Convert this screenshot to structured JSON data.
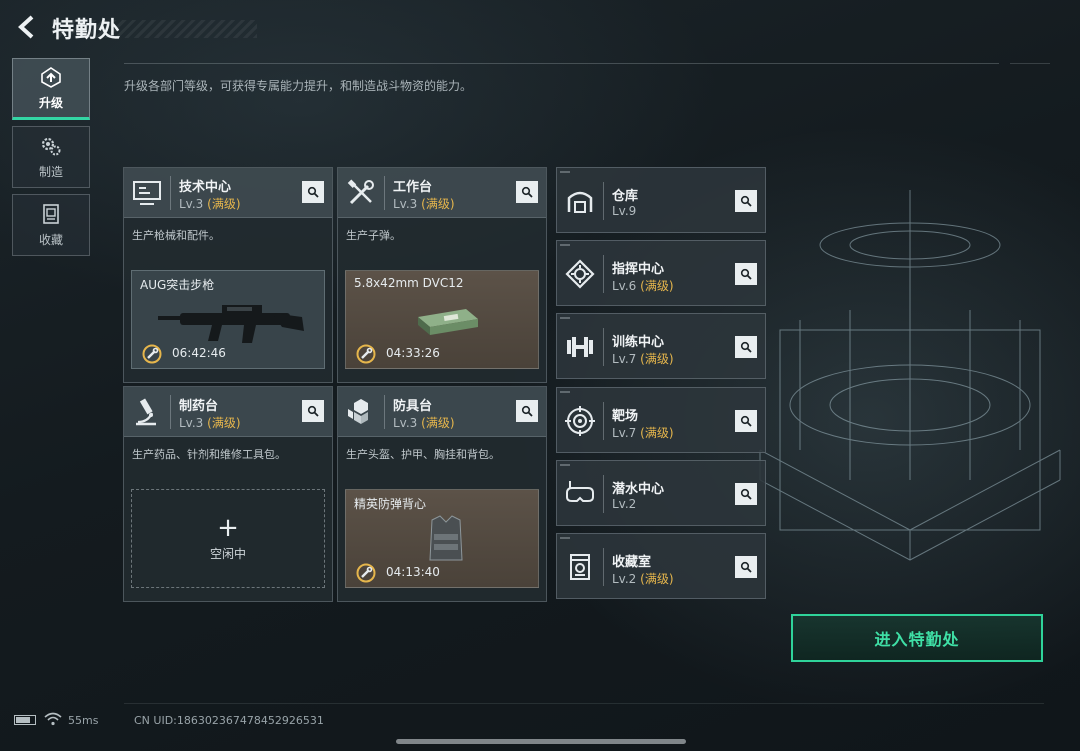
{
  "header": {
    "title": "特勤处"
  },
  "description": "升级各部门等级，可获得专属能力提升，和制造战斗物资的能力。",
  "sidebar": {
    "items": [
      {
        "label": "升级",
        "icon": "upgrade-icon",
        "active": true
      },
      {
        "label": "制造",
        "icon": "gears-icon",
        "active": false
      },
      {
        "label": "收藏",
        "icon": "collection-icon",
        "active": false
      }
    ]
  },
  "departments": [
    {
      "name": "技术中心",
      "level": "Lv.3",
      "max": "(满级)",
      "icon": "monitor-icon",
      "desc": "生产枪械和配件。",
      "slot": {
        "state": "producing",
        "item": "AUG突击步枪",
        "timer": "06:42:46"
      }
    },
    {
      "name": "工作台",
      "level": "Lv.3",
      "max": "(满级)",
      "icon": "tools-icon",
      "desc": "生产子弹。",
      "slot": {
        "state": "producing",
        "item": "5.8x42mm DVC12",
        "timer": "04:33:26"
      }
    },
    {
      "name": "制药台",
      "level": "Lv.3",
      "max": "(满级)",
      "icon": "microscope-icon",
      "desc": "生产药品、针剂和维修工具包。",
      "slot": {
        "state": "idle",
        "idle_label": "空闲中",
        "plus": "+"
      }
    },
    {
      "name": "防具台",
      "level": "Lv.3",
      "max": "(满级)",
      "icon": "armor-icon",
      "desc": "生产头盔、护甲、胸挂和背包。",
      "slot": {
        "state": "producing",
        "item": "精英防弹背心",
        "timer": "04:13:40"
      }
    }
  ],
  "facilities": [
    {
      "name": "仓库",
      "level": "Lv.9",
      "max": "",
      "icon": "warehouse-icon"
    },
    {
      "name": "指挥中心",
      "level": "Lv.6",
      "max": "(满级)",
      "icon": "command-icon"
    },
    {
      "name": "训练中心",
      "level": "Lv.7",
      "max": "(满级)",
      "icon": "dumbbell-icon"
    },
    {
      "name": "靶场",
      "level": "Lv.7",
      "max": "(满级)",
      "icon": "target-icon"
    },
    {
      "name": "潜水中心",
      "level": "Lv.2",
      "max": "",
      "icon": "diving-mask-icon"
    },
    {
      "name": "收藏室",
      "level": "Lv.2",
      "max": "(满级)",
      "icon": "collection-room-icon"
    }
  ],
  "enter_button": "进入特勤处",
  "footer": {
    "ping": "55ms",
    "uid": "CN UID:1863023674784529​26531"
  },
  "colors": {
    "accent": "#33d6a4",
    "max_level": "#e6b64c",
    "button_text": "#3fe0a6"
  }
}
